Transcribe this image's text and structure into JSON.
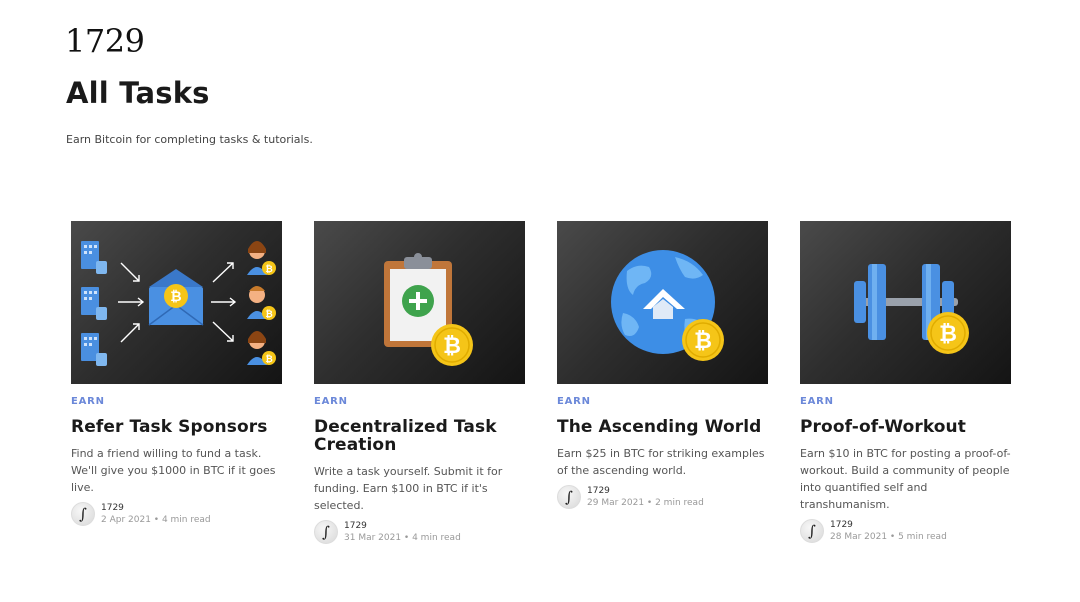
{
  "site": {
    "logo": "1729"
  },
  "header": {
    "title": "All Tasks",
    "subtitle": "Earn Bitcoin for completing tasks & tutorials."
  },
  "cards": [
    {
      "tag": "EARN",
      "title": "Refer Task Sponsors",
      "excerpt": "Find a friend willing to fund a task. We'll give you $1000 in BTC if it goes live.",
      "author": "1729",
      "date": "2 Apr 2021",
      "read_time": "4 min read",
      "meta": "2 Apr 2021 • 4 min read",
      "image_icon": "refer-envelope-icon"
    },
    {
      "tag": "EARN",
      "title": "Decentralized Task Creation",
      "excerpt": "Write a task yourself. Submit it for funding. Earn $100 in BTC if it's selected.",
      "author": "1729",
      "date": "31 Mar 2021",
      "read_time": "4 min read",
      "meta": "31 Mar 2021 • 4 min read",
      "image_icon": "clipboard-plus-icon"
    },
    {
      "tag": "EARN",
      "title": "The Ascending World",
      "excerpt": "Earn $25 in BTC for striking examples of the ascending world.",
      "author": "1729",
      "date": "29 Mar 2021",
      "read_time": "2 min read",
      "meta": "29 Mar 2021 • 2 min read",
      "image_icon": "globe-icon"
    },
    {
      "tag": "EARN",
      "title": "Proof-of-Workout",
      "excerpt": "Earn $10 in BTC for posting a proof-of-workout. Build a community of people into quantified self and transhumanism.",
      "author": "1729",
      "date": "28 Mar 2021",
      "read_time": "5 min read",
      "meta": "28 Mar 2021 • 5 min read",
      "image_icon": "dumbbell-icon"
    }
  ],
  "colors": {
    "accent": "#6b88d9",
    "bitcoin": "#f5c518",
    "thumb_bg": "#2e2e2e",
    "icon_blue": "#4a90e2"
  }
}
